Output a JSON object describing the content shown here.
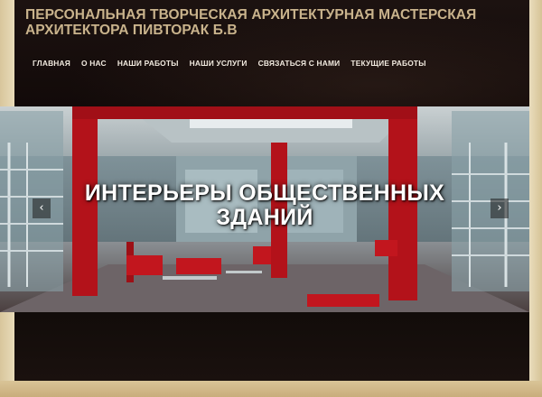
{
  "site": {
    "title": "ПЕРСОНАЛЬНАЯ ТВОРЧЕСКАЯ АРХИТЕКТУРНАЯ МАСТЕРСКАЯ АРХИТЕКТОРА ПИВТОРАК Б.В",
    "tagline": ""
  },
  "nav": {
    "items": [
      {
        "label": "ГЛАВНАЯ"
      },
      {
        "label": "О НАС"
      },
      {
        "label": "НАШИ РАБОТЫ"
      },
      {
        "label": "НАШИ УСЛУГИ"
      },
      {
        "label": "СВЯЗАТЬСЯ С НАМИ"
      },
      {
        "label": "ТЕКУЩИЕ РАБОТЫ"
      }
    ]
  },
  "slider": {
    "caption": "ИНТЕРЬЕРЫ ОБЩЕСТВЕННЫХ ЗДАНИЙ",
    "prev_icon": "chevron-left-icon",
    "next_icon": "chevron-right-icon"
  },
  "colors": {
    "header_bg": "#150d0b",
    "title": "#c9b38c",
    "nav_text": "#f2ebe0",
    "accent_red": "#b3121a",
    "paper": "#e6d8b6"
  }
}
